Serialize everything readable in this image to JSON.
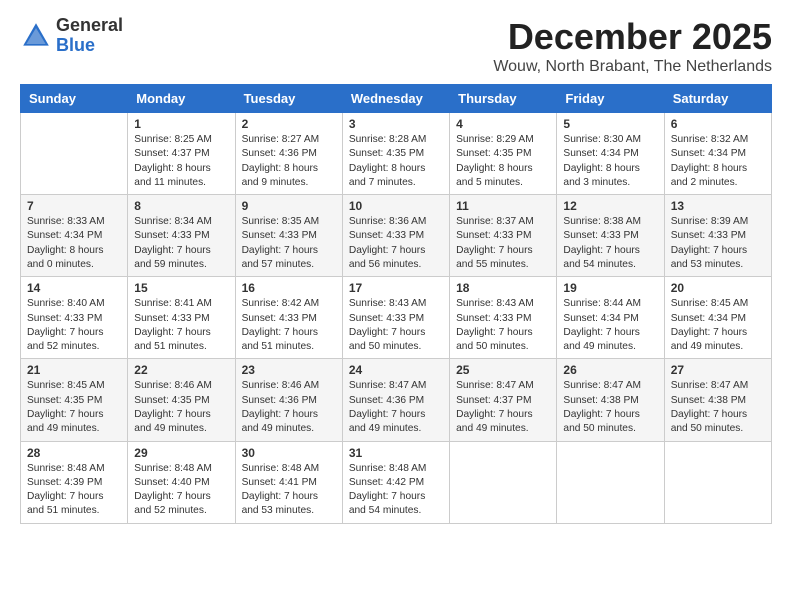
{
  "logo": {
    "general": "General",
    "blue": "Blue"
  },
  "title": "December 2025",
  "location": "Wouw, North Brabant, The Netherlands",
  "days_of_week": [
    "Sunday",
    "Monday",
    "Tuesday",
    "Wednesday",
    "Thursday",
    "Friday",
    "Saturday"
  ],
  "weeks": [
    [
      {
        "num": "",
        "sunrise": "",
        "sunset": "",
        "daylight": ""
      },
      {
        "num": "1",
        "sunrise": "Sunrise: 8:25 AM",
        "sunset": "Sunset: 4:37 PM",
        "daylight": "Daylight: 8 hours and 11 minutes."
      },
      {
        "num": "2",
        "sunrise": "Sunrise: 8:27 AM",
        "sunset": "Sunset: 4:36 PM",
        "daylight": "Daylight: 8 hours and 9 minutes."
      },
      {
        "num": "3",
        "sunrise": "Sunrise: 8:28 AM",
        "sunset": "Sunset: 4:35 PM",
        "daylight": "Daylight: 8 hours and 7 minutes."
      },
      {
        "num": "4",
        "sunrise": "Sunrise: 8:29 AM",
        "sunset": "Sunset: 4:35 PM",
        "daylight": "Daylight: 8 hours and 5 minutes."
      },
      {
        "num": "5",
        "sunrise": "Sunrise: 8:30 AM",
        "sunset": "Sunset: 4:34 PM",
        "daylight": "Daylight: 8 hours and 3 minutes."
      },
      {
        "num": "6",
        "sunrise": "Sunrise: 8:32 AM",
        "sunset": "Sunset: 4:34 PM",
        "daylight": "Daylight: 8 hours and 2 minutes."
      }
    ],
    [
      {
        "num": "7",
        "sunrise": "Sunrise: 8:33 AM",
        "sunset": "Sunset: 4:34 PM",
        "daylight": "Daylight: 8 hours and 0 minutes."
      },
      {
        "num": "8",
        "sunrise": "Sunrise: 8:34 AM",
        "sunset": "Sunset: 4:33 PM",
        "daylight": "Daylight: 7 hours and 59 minutes."
      },
      {
        "num": "9",
        "sunrise": "Sunrise: 8:35 AM",
        "sunset": "Sunset: 4:33 PM",
        "daylight": "Daylight: 7 hours and 57 minutes."
      },
      {
        "num": "10",
        "sunrise": "Sunrise: 8:36 AM",
        "sunset": "Sunset: 4:33 PM",
        "daylight": "Daylight: 7 hours and 56 minutes."
      },
      {
        "num": "11",
        "sunrise": "Sunrise: 8:37 AM",
        "sunset": "Sunset: 4:33 PM",
        "daylight": "Daylight: 7 hours and 55 minutes."
      },
      {
        "num": "12",
        "sunrise": "Sunrise: 8:38 AM",
        "sunset": "Sunset: 4:33 PM",
        "daylight": "Daylight: 7 hours and 54 minutes."
      },
      {
        "num": "13",
        "sunrise": "Sunrise: 8:39 AM",
        "sunset": "Sunset: 4:33 PM",
        "daylight": "Daylight: 7 hours and 53 minutes."
      }
    ],
    [
      {
        "num": "14",
        "sunrise": "Sunrise: 8:40 AM",
        "sunset": "Sunset: 4:33 PM",
        "daylight": "Daylight: 7 hours and 52 minutes."
      },
      {
        "num": "15",
        "sunrise": "Sunrise: 8:41 AM",
        "sunset": "Sunset: 4:33 PM",
        "daylight": "Daylight: 7 hours and 51 minutes."
      },
      {
        "num": "16",
        "sunrise": "Sunrise: 8:42 AM",
        "sunset": "Sunset: 4:33 PM",
        "daylight": "Daylight: 7 hours and 51 minutes."
      },
      {
        "num": "17",
        "sunrise": "Sunrise: 8:43 AM",
        "sunset": "Sunset: 4:33 PM",
        "daylight": "Daylight: 7 hours and 50 minutes."
      },
      {
        "num": "18",
        "sunrise": "Sunrise: 8:43 AM",
        "sunset": "Sunset: 4:33 PM",
        "daylight": "Daylight: 7 hours and 50 minutes."
      },
      {
        "num": "19",
        "sunrise": "Sunrise: 8:44 AM",
        "sunset": "Sunset: 4:34 PM",
        "daylight": "Daylight: 7 hours and 49 minutes."
      },
      {
        "num": "20",
        "sunrise": "Sunrise: 8:45 AM",
        "sunset": "Sunset: 4:34 PM",
        "daylight": "Daylight: 7 hours and 49 minutes."
      }
    ],
    [
      {
        "num": "21",
        "sunrise": "Sunrise: 8:45 AM",
        "sunset": "Sunset: 4:35 PM",
        "daylight": "Daylight: 7 hours and 49 minutes."
      },
      {
        "num": "22",
        "sunrise": "Sunrise: 8:46 AM",
        "sunset": "Sunset: 4:35 PM",
        "daylight": "Daylight: 7 hours and 49 minutes."
      },
      {
        "num": "23",
        "sunrise": "Sunrise: 8:46 AM",
        "sunset": "Sunset: 4:36 PM",
        "daylight": "Daylight: 7 hours and 49 minutes."
      },
      {
        "num": "24",
        "sunrise": "Sunrise: 8:47 AM",
        "sunset": "Sunset: 4:36 PM",
        "daylight": "Daylight: 7 hours and 49 minutes."
      },
      {
        "num": "25",
        "sunrise": "Sunrise: 8:47 AM",
        "sunset": "Sunset: 4:37 PM",
        "daylight": "Daylight: 7 hours and 49 minutes."
      },
      {
        "num": "26",
        "sunrise": "Sunrise: 8:47 AM",
        "sunset": "Sunset: 4:38 PM",
        "daylight": "Daylight: 7 hours and 50 minutes."
      },
      {
        "num": "27",
        "sunrise": "Sunrise: 8:47 AM",
        "sunset": "Sunset: 4:38 PM",
        "daylight": "Daylight: 7 hours and 50 minutes."
      }
    ],
    [
      {
        "num": "28",
        "sunrise": "Sunrise: 8:48 AM",
        "sunset": "Sunset: 4:39 PM",
        "daylight": "Daylight: 7 hours and 51 minutes."
      },
      {
        "num": "29",
        "sunrise": "Sunrise: 8:48 AM",
        "sunset": "Sunset: 4:40 PM",
        "daylight": "Daylight: 7 hours and 52 minutes."
      },
      {
        "num": "30",
        "sunrise": "Sunrise: 8:48 AM",
        "sunset": "Sunset: 4:41 PM",
        "daylight": "Daylight: 7 hours and 53 minutes."
      },
      {
        "num": "31",
        "sunrise": "Sunrise: 8:48 AM",
        "sunset": "Sunset: 4:42 PM",
        "daylight": "Daylight: 7 hours and 54 minutes."
      },
      {
        "num": "",
        "sunrise": "",
        "sunset": "",
        "daylight": ""
      },
      {
        "num": "",
        "sunrise": "",
        "sunset": "",
        "daylight": ""
      },
      {
        "num": "",
        "sunrise": "",
        "sunset": "",
        "daylight": ""
      }
    ]
  ]
}
